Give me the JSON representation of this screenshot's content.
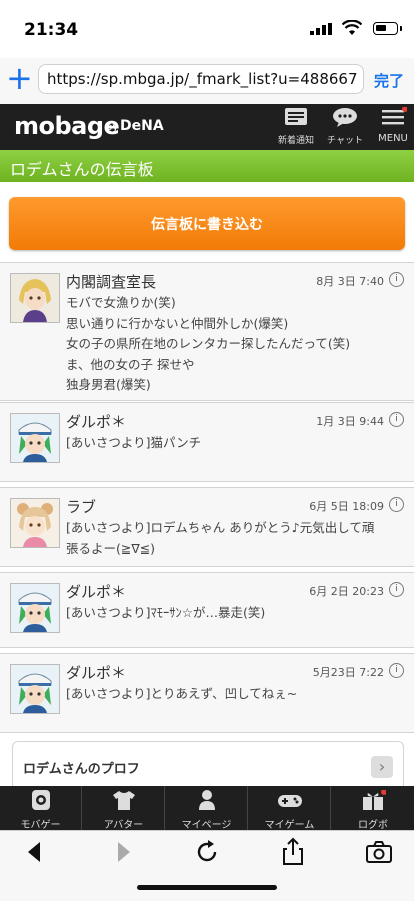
{
  "status": {
    "time": "21:34"
  },
  "browser": {
    "url": "https://sp.mbga.jp/_fmark_list?u=488667...",
    "done_label": "完了"
  },
  "header": {
    "logo": "mobage",
    "by": "by",
    "brand": "DeNA",
    "nav": [
      {
        "label": "新着通知",
        "icon": "notification-icon"
      },
      {
        "label": "チャット",
        "icon": "chat-icon"
      },
      {
        "label": "MENU",
        "icon": "menu-icon"
      }
    ]
  },
  "page": {
    "title": "ロデムさんの伝言板",
    "write_button": "伝言板に書き込む"
  },
  "posts": [
    {
      "name": "内閣調査室長",
      "date": "8月 3日 7:40",
      "lines": [
        "モバで女漁りか(笑)",
        "思い通りに行かないと仲間外しか(爆笑)",
        "女の子の県所在地のレンタカー探したんだって(笑)",
        "ま、他の女の子 探せや",
        "独身男君(爆笑)"
      ]
    },
    {
      "name": "ダルポ＊",
      "date": "1月 3日 9:44",
      "lines": [
        "[あいさつより]猫パンチ"
      ]
    },
    {
      "name": "ラブ",
      "date": "6月 5日 18:09",
      "lines": [
        "[あいさつより]ロデムちゃん ありがとう♪元気出して頑",
        "張るよー(≧∇≦)"
      ]
    },
    {
      "name": "ダルポ＊",
      "date": "6月 2日 20:23",
      "lines": [
        "[あいさつより]ﾏﾓｰｻﾝ☆が…暴走(笑)"
      ]
    },
    {
      "name": "ダルポ＊",
      "date": "5月23日 7:22",
      "lines": [
        "[あいさつより]とりあえず、凹してねぇ~"
      ]
    }
  ],
  "profile_link": "ロデムさんのプロフ",
  "tabbar": [
    {
      "label": "モバゲー",
      "icon": "mobage-icon"
    },
    {
      "label": "アバター",
      "icon": "avatar-shirt-icon"
    },
    {
      "label": "マイページ",
      "icon": "person-icon"
    },
    {
      "label": "マイゲーム",
      "icon": "gamepad-icon"
    },
    {
      "label": "ログボ",
      "icon": "gift-icon"
    }
  ],
  "colors": {
    "accent_green": "#7cc22d",
    "button_orange": "#f5870e",
    "header_dark": "#1f1f1f",
    "link_blue": "#1a73e8"
  }
}
